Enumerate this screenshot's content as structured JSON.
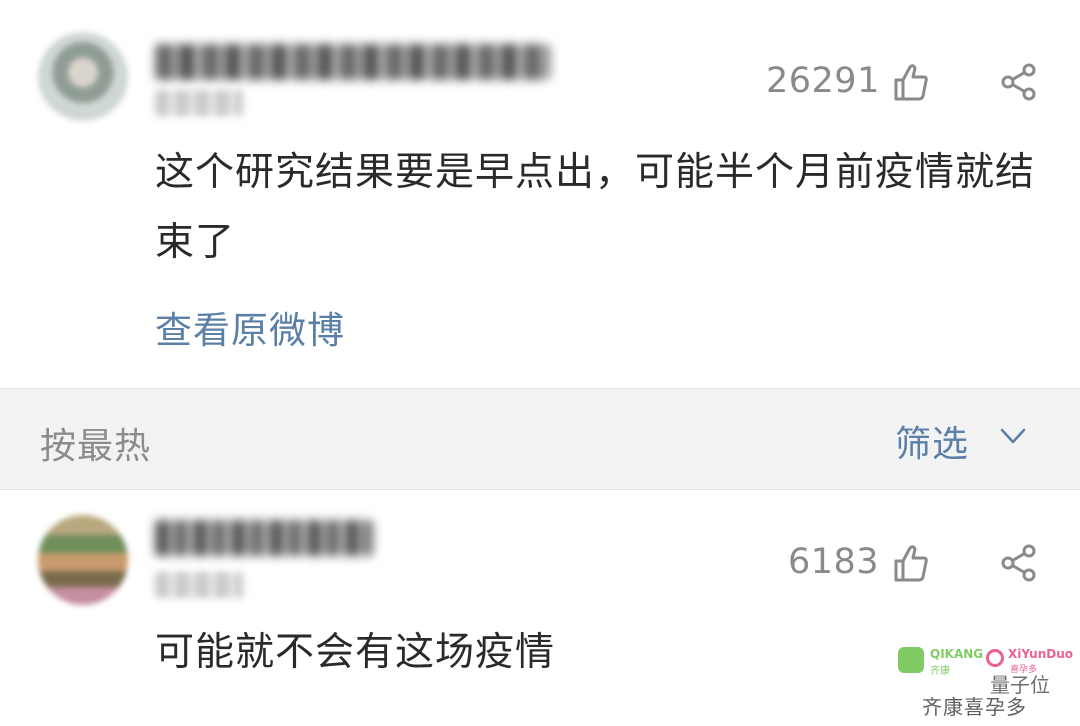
{
  "comments": [
    {
      "likes": "26291",
      "text": "这个研究结果要是早点出，可能半个月前疫情就结束了",
      "link": "查看原微博"
    },
    {
      "likes": "6183",
      "text": "可能就不会有这场疫情"
    }
  ],
  "sort": {
    "label": "按最热",
    "filter_label": "筛选"
  },
  "watermark": {
    "qikang": "QIKANG",
    "qikang_cn": "齐康",
    "xiyunduo": "XiYunDuo",
    "xiyunduo_cn": "喜孕多",
    "brand": "量子位",
    "sub": "齐康喜孕多"
  },
  "colors": {
    "link": "#5b7fa6",
    "count": "#8a8a8a",
    "sort_bg": "#f3f3f3"
  },
  "icons": [
    "thumbs-up-icon",
    "share-icon",
    "chevron-down-icon"
  ]
}
